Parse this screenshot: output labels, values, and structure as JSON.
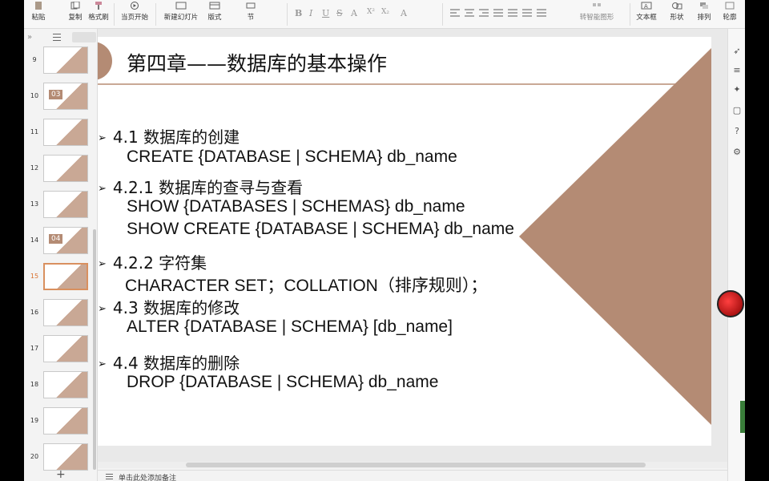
{
  "ribbon": {
    "paste_label": "粘贴",
    "copy_label": "复制",
    "format_painter_label": "格式刷",
    "from_current_label": "当页开始",
    "new_slide_label": "新建幻灯片",
    "layout_label": "版式",
    "section_label": "节",
    "smart_graphic_label": "转智能图形",
    "textbox_label": "文本框",
    "shape_label": "形状",
    "arrange_label": "排列",
    "outline_label": "轮廓",
    "format_glyphs": [
      "B",
      "I",
      "U",
      "S",
      "A",
      "X²",
      "X₂",
      "A"
    ]
  },
  "thumbnails": [
    {
      "num": "9"
    },
    {
      "num": "10",
      "caption": "03"
    },
    {
      "num": "11"
    },
    {
      "num": "12"
    },
    {
      "num": "13"
    },
    {
      "num": "14",
      "caption": "04"
    },
    {
      "num": "15",
      "active": true
    },
    {
      "num": "16"
    },
    {
      "num": "17"
    },
    {
      "num": "18"
    },
    {
      "num": "19"
    },
    {
      "num": "20"
    }
  ],
  "add_slide_label": "+",
  "slide": {
    "title": "第四章——数据库的基本操作",
    "bullets": [
      {
        "heading": "4.1 数据库的创建",
        "lines": [
          "CREATE {DATABASE | SCHEMA}  db_name"
        ]
      },
      {
        "heading": "4.2.1 数据库的查寻与查看",
        "lines": [
          "SHOW {DATABASES | SCHEMAS} db_name",
          "SHOW CREATE {DATABASE | SCHEMA}  db_name"
        ]
      },
      {
        "heading": "4.2.2 字符集",
        "lines": [
          "CHARACTER SET；COLLATION（排序规则）；"
        ]
      },
      {
        "heading": "4.3 数据库的修改",
        "lines": [
          "ALTER {DATABASE | SCHEMA} [db_name]"
        ]
      },
      {
        "heading": "4.4 数据库的删除",
        "lines": [
          "DROP {DATABASE | SCHEMA}  db_name"
        ]
      }
    ],
    "colors": {
      "accent": "#b48b74",
      "line": "#c9a895"
    }
  },
  "status": {
    "notes_placeholder": "单击此处添加备注"
  }
}
